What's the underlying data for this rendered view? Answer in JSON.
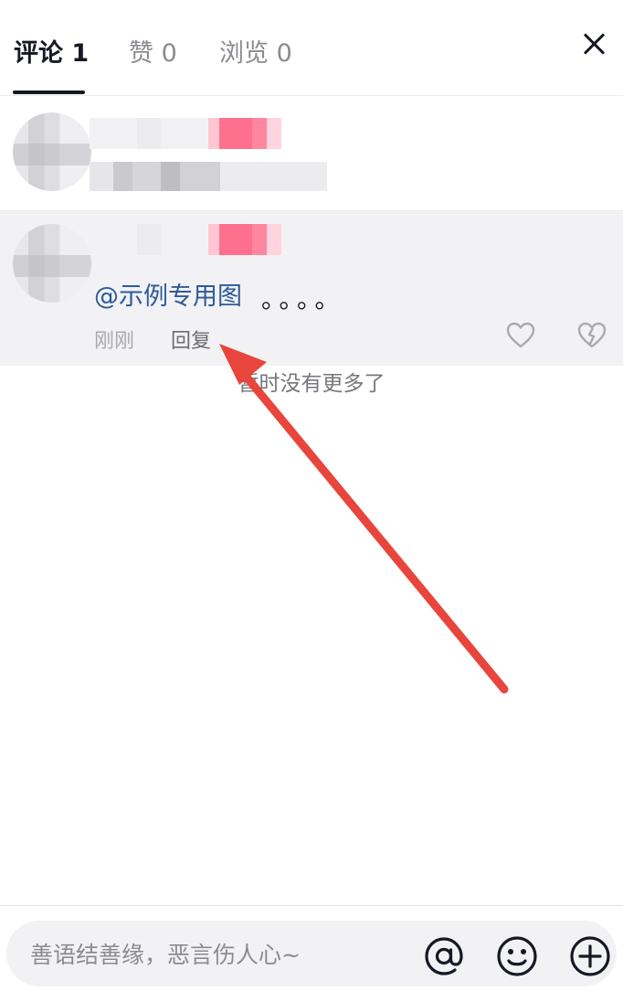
{
  "tabs": [
    {
      "label": "评论 1",
      "active": true
    },
    {
      "label": "赞 0",
      "active": false
    },
    {
      "label": "浏览 0",
      "active": false
    }
  ],
  "comment": {
    "mention": "@示例专用图",
    "text": "。。。。",
    "time": "刚刚",
    "reply_label": "回复"
  },
  "no_more_text": "暂时没有更多了",
  "composer": {
    "placeholder": "善语结善缘，恶言伤人心~"
  },
  "icons": {
    "close": "close-icon",
    "like": "heart-outline-icon",
    "dislike": "broken-heart-icon",
    "at": "at-sign-icon",
    "emoji": "smiley-icon",
    "add": "plus-circle-icon"
  },
  "colors": {
    "accent_text": "#161823",
    "mention": "#2e5a99",
    "annotation_arrow": "#e8453c"
  }
}
